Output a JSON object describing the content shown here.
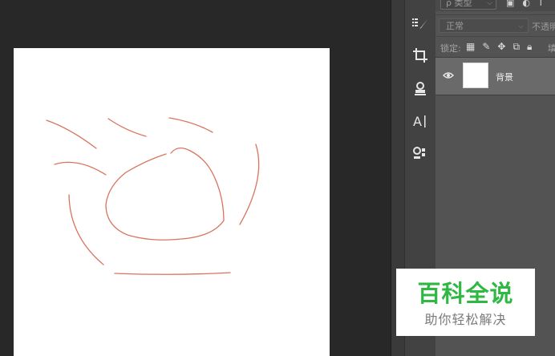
{
  "layers_panel": {
    "filter_select_value": "ρ 类型",
    "filter_icons": [
      "image-filter-icon",
      "adjustment-filter-icon",
      "type-filter-icon"
    ],
    "blend_mode_value": "正常",
    "opacity_label": "不透明",
    "lock_label": "锁定:",
    "lock_icons": [
      "lock-transparent-icon",
      "lock-paint-icon",
      "lock-position-icon",
      "lock-artboard-icon",
      "lock-all-icon"
    ],
    "fill_label": "填",
    "layers": [
      {
        "name": "背景",
        "visible": true,
        "selected": true
      }
    ]
  },
  "tools": [
    "brush-icon",
    "crop-icon",
    "stamp-icon",
    "type-icon",
    "3d-object-icon"
  ],
  "watermark": {
    "title": "百科全说",
    "subtitle": "助你轻松解决",
    "title_color": "#2fb842"
  },
  "colors": {
    "canvas_background": "#282828",
    "document": "#ffffff",
    "stroke": "#d9735f",
    "panel": "#535353",
    "selected_layer": "#6a6a6a"
  }
}
